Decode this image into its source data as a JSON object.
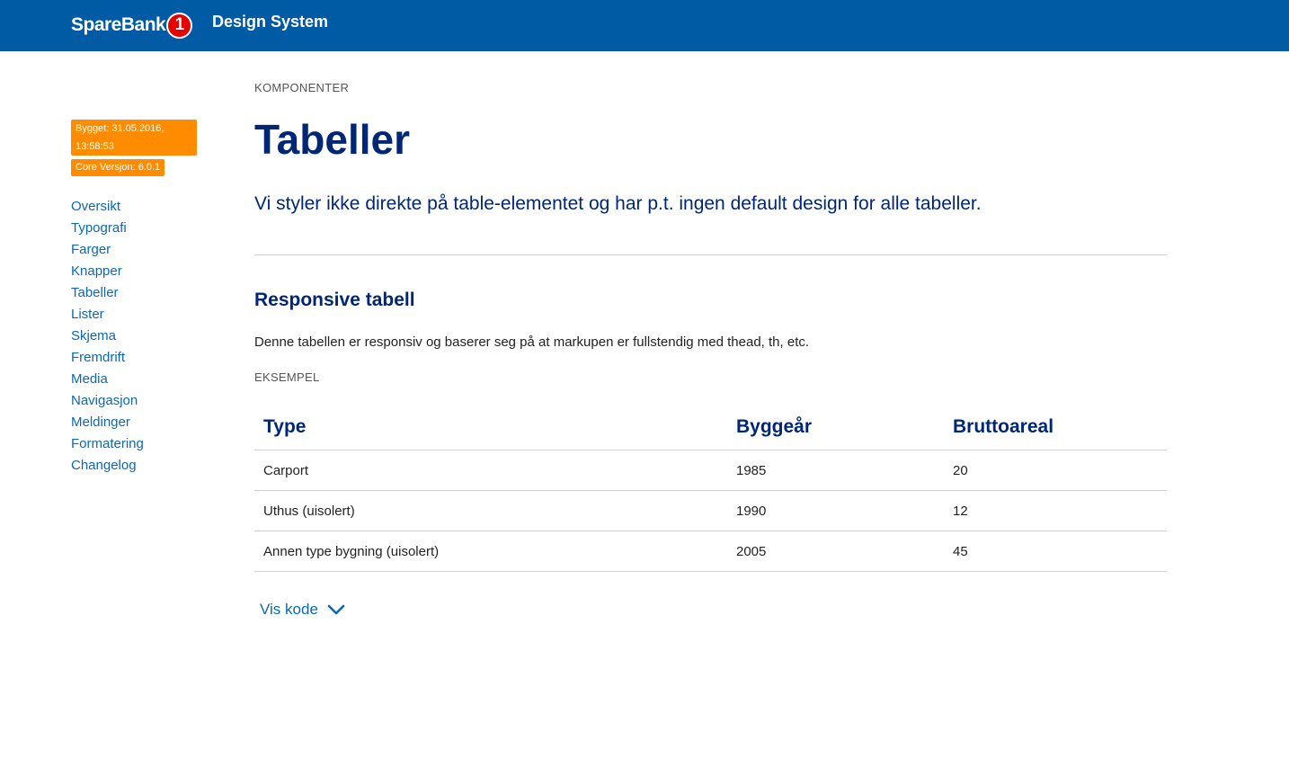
{
  "header": {
    "logo_text": "SpareBank",
    "logo_badge": "1",
    "title": "Design System"
  },
  "sidebar": {
    "build_badge": "Bygget: 31.05.2016, 13:58:53",
    "core_badge": "Core Versjon: 6.0.1",
    "items": [
      {
        "label": "Oversikt"
      },
      {
        "label": "Typografi"
      },
      {
        "label": "Farger"
      },
      {
        "label": "Knapper"
      },
      {
        "label": "Tabeller"
      },
      {
        "label": "Lister"
      },
      {
        "label": "Skjema"
      },
      {
        "label": "Fremdrift"
      },
      {
        "label": "Media"
      },
      {
        "label": "Navigasjon"
      },
      {
        "label": "Meldinger"
      },
      {
        "label": "Formatering"
      },
      {
        "label": "Changelog"
      }
    ]
  },
  "main": {
    "eyebrow": "KOMPONENTER",
    "title": "Tabeller",
    "lead": "Vi styler ikke direkte på table-elementet og har p.t. ingen default design for alle tabeller.",
    "section": {
      "title": "Responsive tabell",
      "text": "Denne tabellen er responsiv og baserer seg på at markupen er fullstendig med thead, th, etc.",
      "example_label": "EKSEMPEL"
    },
    "table": {
      "headers": [
        "Type",
        "Byggeår",
        "Bruttoareal"
      ],
      "rows": [
        [
          "Carport",
          "1985",
          "20"
        ],
        [
          "Uthus (uisolert)",
          "1990",
          "12"
        ],
        [
          "Annen type bygning (uisolert)",
          "2005",
          "45"
        ]
      ]
    },
    "code_toggle": "Vis kode"
  },
  "colors": {
    "header_bg": "#005aa4",
    "heading": "#002776",
    "link": "#0b68b5",
    "badge": "#ff8c00",
    "logo_badge": "#e60000"
  }
}
